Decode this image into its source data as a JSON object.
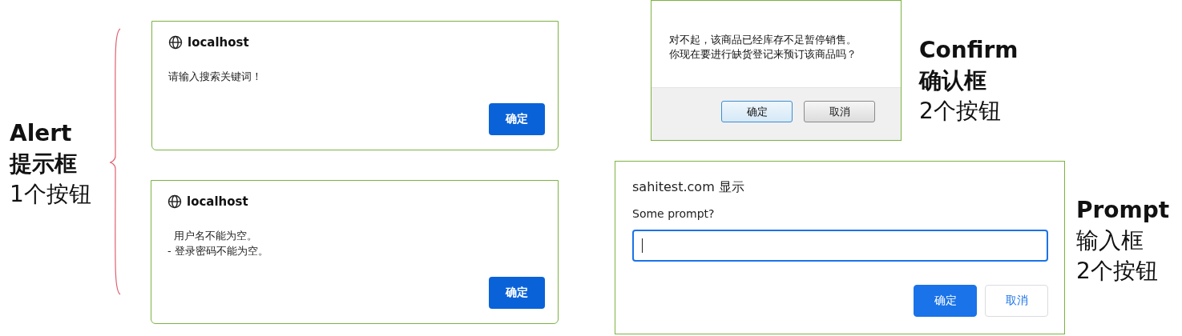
{
  "annotations": [
    {
      "lines": [
        {
          "text": "Alert",
          "bold": true
        },
        {
          "text": "提示框",
          "bold": true
        },
        {
          "text": "1个按钮",
          "bold": false
        }
      ]
    },
    {
      "lines": [
        {
          "text": "Confirm",
          "bold": true
        },
        {
          "text": "确认框",
          "bold": true
        },
        {
          "text": "2个按钮",
          "bold": false
        }
      ]
    },
    {
      "lines": [
        {
          "text": "Prompt",
          "bold": true
        },
        {
          "text": "输入框",
          "bold": false
        },
        {
          "text": "2个按钮",
          "bold": false
        }
      ]
    }
  ],
  "dialogs": [
    {
      "kind": "alert",
      "title": "localhost",
      "message": [
        "请输入搜索关键词！"
      ],
      "buttons": [
        {
          "label": "确定",
          "primary": true
        }
      ]
    },
    {
      "kind": "alert",
      "title": "localhost",
      "message": [
        "  用户名不能为空。",
        "- 登录密码不能为空。"
      ],
      "buttons": [
        {
          "label": "确定",
          "primary": true
        }
      ]
    },
    {
      "kind": "confirm",
      "message": [
        "对不起，该商品已经库存不足暂停销售。",
        "你现在要进行缺货登记来预订该商品吗？"
      ],
      "buttons": [
        {
          "label": "确定",
          "primary": true
        },
        {
          "label": "取消",
          "primary": false
        }
      ]
    },
    {
      "kind": "prompt",
      "title": "sahitest.com 显示",
      "message": [
        "Some prompt?"
      ],
      "buttons": [
        {
          "label": "确定",
          "primary": true
        },
        {
          "label": "取消",
          "primary": false
        }
      ]
    }
  ]
}
